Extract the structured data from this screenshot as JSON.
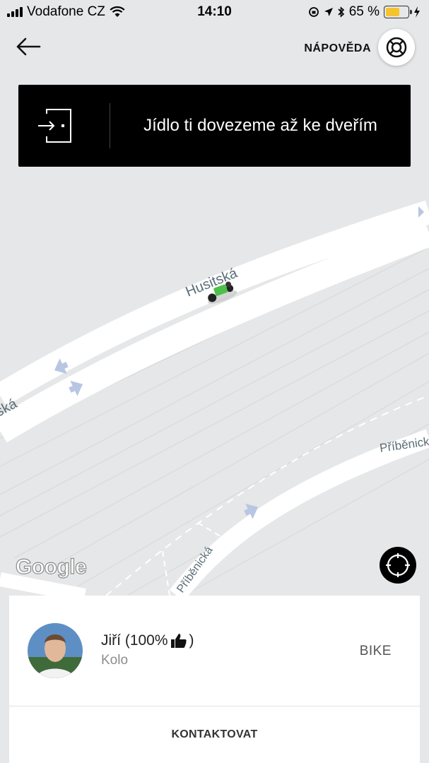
{
  "status_bar": {
    "carrier": "Vodafone CZ",
    "time": "14:10",
    "battery_text": "65 %",
    "battery_level": 0.65
  },
  "header": {
    "back_icon": "arrow-left-icon",
    "help_label": "NÁPOVĚDA",
    "help_icon": "lifebuoy-icon"
  },
  "banner": {
    "icon": "door-enter-icon",
    "text": "Jídlo ti dovezeme až ke dveřím"
  },
  "map": {
    "street_names": [
      "Husitská",
      "ská",
      "Příběnick",
      "Příběnická"
    ],
    "attribution": "Google",
    "recenter_icon": "locate-icon",
    "courier_marker": "bike-courier-icon"
  },
  "courier": {
    "name": "Jiří (100%",
    "closing": ")",
    "rating_icon": "thumbs-up-icon",
    "vehicle": "Kolo",
    "vehicle_type": "BIKE"
  },
  "actions": {
    "contact_label": "KONTAKTOVAT"
  },
  "colors": {
    "map_bg": "#e6e7e8",
    "road": "#ffffff",
    "battery": "#f4c430",
    "banner_bg": "#000000",
    "courier_marker": "#4cc04a"
  }
}
